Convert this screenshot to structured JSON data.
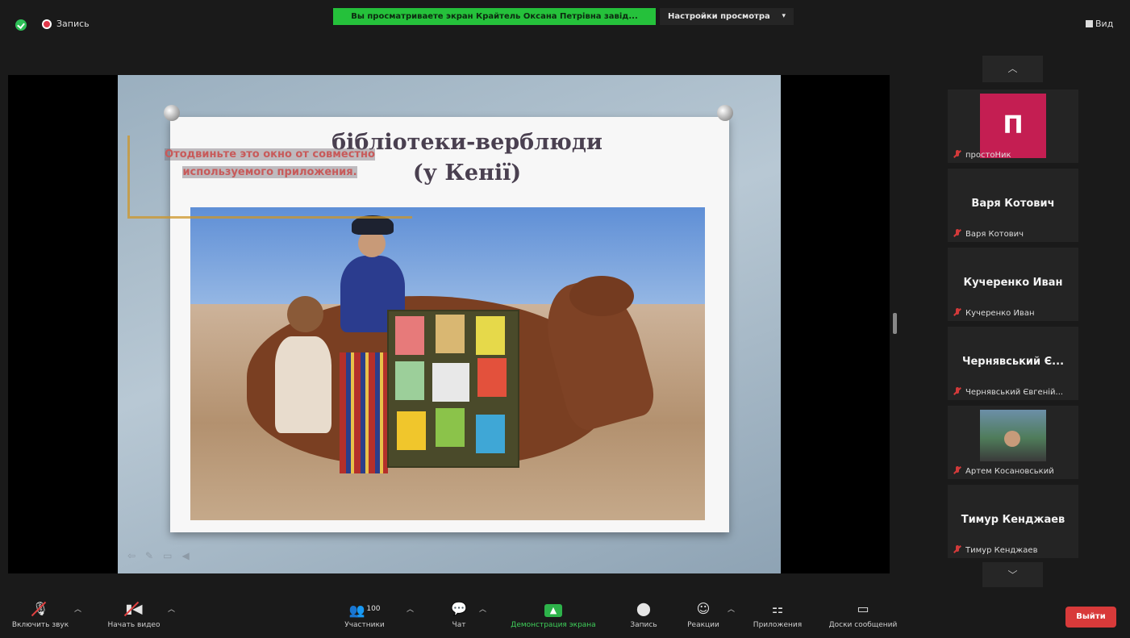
{
  "topbar": {
    "security_icon": "shield-check-icon",
    "recording_label": "Запись",
    "share_banner": "Вы просматриваете экран Крайтель Оксана Петрівна завід...",
    "view_options_label": "Настройки просмотра",
    "view_button_label": "Вид"
  },
  "slide": {
    "title_line1": "бібліотеки-верблюди",
    "title_line2": "(у Кенії)",
    "watermark_line1": "Отодвиньте это окно от совместно",
    "watermark_line2": "используемого приложения."
  },
  "participants": [
    {
      "display": "П",
      "name": "простоНик",
      "type": "avatar-letter",
      "color": "#c41e52"
    },
    {
      "display": "Варя Котович",
      "name": "Варя Котович",
      "type": "name"
    },
    {
      "display": "Кучеренко Иван",
      "name": "Кучеренко Иван",
      "type": "name"
    },
    {
      "display": "Чернявський Є...",
      "name": "Чернявський Євгеній...",
      "type": "name"
    },
    {
      "display": "",
      "name": "Артем Косановський",
      "type": "photo"
    },
    {
      "display": "Тимур Кенджаев",
      "name": "Тимур Кенджаев",
      "type": "name"
    }
  ],
  "toolbar": {
    "unmute_label": "Включить звук",
    "start_video_label": "Начать видео",
    "participants_label": "Участники",
    "participants_count": "100",
    "chat_label": "Чат",
    "share_label": "Демонстрация экрана",
    "record_label": "Запись",
    "reactions_label": "Реакции",
    "apps_label": "Приложения",
    "whiteboards_label": "Доски сообщений",
    "leave_label": "Выйти"
  },
  "colors": {
    "banner_green": "#25c13b",
    "leave_red": "#d83a3a",
    "share_green": "#2db34a"
  }
}
